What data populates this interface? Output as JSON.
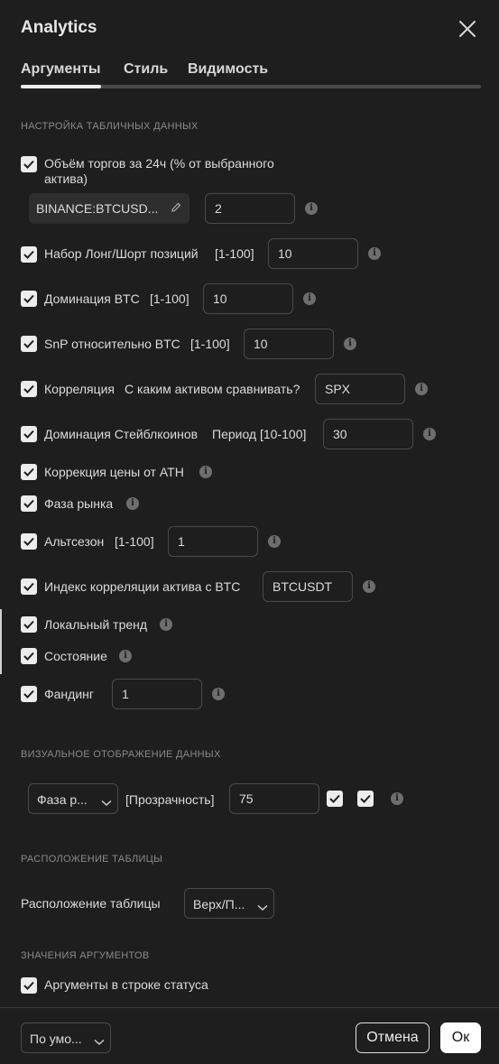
{
  "title": "Analytics",
  "tabs": [
    {
      "label": "Аргументы",
      "active": true
    },
    {
      "label": "Стиль",
      "active": false
    },
    {
      "label": "Видимость",
      "active": false
    }
  ],
  "sections": {
    "table_data": "НАСТРОЙКА ТАБЛИЧНЫХ ДАННЫХ",
    "visual": "ВИЗУАЛЬНОЕ ОТОБРАЖЕНИЕ ДАННЫХ",
    "table_position": "РАСПОЛОЖЕНИЕ ТАБЛИЦЫ",
    "arg_values": "ЗНАЧЕНИЯ АРГУМЕНТОВ"
  },
  "volume": {
    "label_line1": "Объём торгов за 24ч (% от выбранного",
    "label_line2": "актива)",
    "symbol": "BINANCE:BTCUSD...",
    "value": "2"
  },
  "long_short": {
    "label": "Набор Лонг/Шорт позиций",
    "range": "[1-100]",
    "value": "10"
  },
  "btc_dominance": {
    "label": "Доминация BTC",
    "range": "[1-100]",
    "value": "10"
  },
  "snp": {
    "label": "SnP относительно BTC",
    "range": "[1-100]",
    "value": "10"
  },
  "correlation": {
    "label": "Корреляция",
    "sub_label": "С каким активом сравнивать?",
    "value": "SPX"
  },
  "stable_dominance": {
    "label": "Доминация Стейблкоинов",
    "sub_label": "Период [10-100]",
    "value": "30"
  },
  "ath_correction": {
    "label": "Коррекция цены от ATH"
  },
  "market_phase": {
    "label": "Фаза рынка"
  },
  "altseason": {
    "label": "Альтсезон",
    "range": "[1-100]",
    "value": "1"
  },
  "corr_index": {
    "label": "Индекс корреляции актива с BTC",
    "value": "BTCUSDT"
  },
  "local_trend": {
    "label": "Локальный тренд"
  },
  "state": {
    "label": "Состояние"
  },
  "funding": {
    "label": "Фандинг",
    "value": "1"
  },
  "visual": {
    "select": "Фаза р...",
    "opacity_label": "[Прозрачность]",
    "opacity_value": "75"
  },
  "table_position": {
    "label": "Расположение таблицы",
    "select": "Верх/П..."
  },
  "arg_status": {
    "label": "Аргументы в строке статуса"
  },
  "footer": {
    "preset": "По умо...",
    "cancel": "Отмена",
    "ok": "Ок"
  },
  "icons": {
    "info": "info-icon",
    "check": "check-icon",
    "close": "close-icon",
    "chevron": "chevron-down-icon",
    "pencil": "pencil-icon"
  },
  "colors": {
    "background": "#1e1e1e",
    "checkbox": "#ececec",
    "border": "#4a4a4a",
    "muted": "#8a8a8a"
  }
}
